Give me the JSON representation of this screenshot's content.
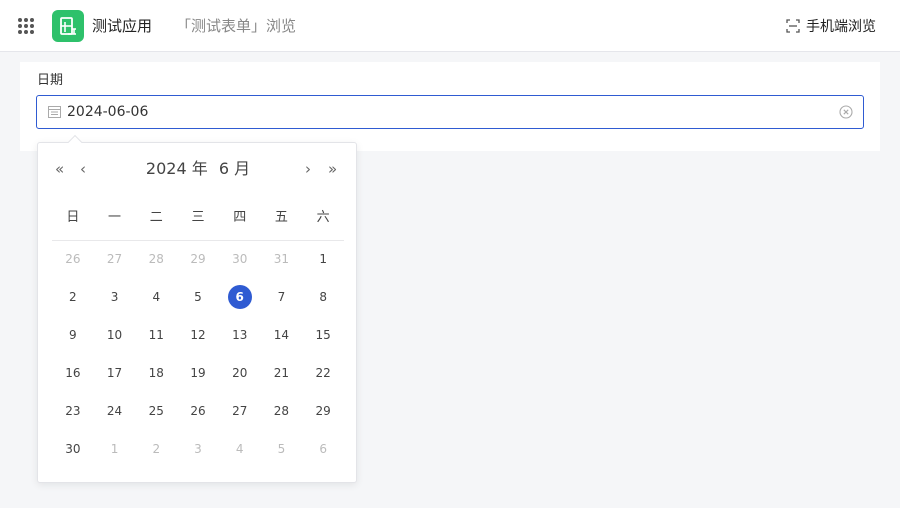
{
  "topbar": {
    "app_name": "测试应用",
    "page_crumb": "「测试表单」浏览",
    "mobile_preview_label": "手机端浏览",
    "app_logo_color": "#2ec16b"
  },
  "form": {
    "field_label": "日期",
    "date_value": "2024-06-06",
    "accent_color": "#2f5bd2"
  },
  "picker": {
    "year_label": "2024 年",
    "month_label": "6 月",
    "nav_prev_year": "«",
    "nav_prev_month": "‹",
    "nav_next_month": "›",
    "nav_next_year": "»",
    "weekdays": [
      "日",
      "一",
      "二",
      "三",
      "四",
      "五",
      "六"
    ],
    "days": [
      {
        "label": "26",
        "muted": true
      },
      {
        "label": "27",
        "muted": true
      },
      {
        "label": "28",
        "muted": true
      },
      {
        "label": "29",
        "muted": true
      },
      {
        "label": "30",
        "muted": true
      },
      {
        "label": "31",
        "muted": true
      },
      {
        "label": "1"
      },
      {
        "label": "2"
      },
      {
        "label": "3"
      },
      {
        "label": "4"
      },
      {
        "label": "5"
      },
      {
        "label": "6",
        "selected": true
      },
      {
        "label": "7"
      },
      {
        "label": "8"
      },
      {
        "label": "9"
      },
      {
        "label": "10"
      },
      {
        "label": "11"
      },
      {
        "label": "12"
      },
      {
        "label": "13"
      },
      {
        "label": "14"
      },
      {
        "label": "15"
      },
      {
        "label": "16"
      },
      {
        "label": "17"
      },
      {
        "label": "18"
      },
      {
        "label": "19"
      },
      {
        "label": "20"
      },
      {
        "label": "21"
      },
      {
        "label": "22"
      },
      {
        "label": "23"
      },
      {
        "label": "24"
      },
      {
        "label": "25"
      },
      {
        "label": "26"
      },
      {
        "label": "27"
      },
      {
        "label": "28"
      },
      {
        "label": "29"
      },
      {
        "label": "30"
      },
      {
        "label": "1",
        "muted": true
      },
      {
        "label": "2",
        "muted": true
      },
      {
        "label": "3",
        "muted": true
      },
      {
        "label": "4",
        "muted": true
      },
      {
        "label": "5",
        "muted": true
      },
      {
        "label": "6",
        "muted": true
      }
    ]
  }
}
